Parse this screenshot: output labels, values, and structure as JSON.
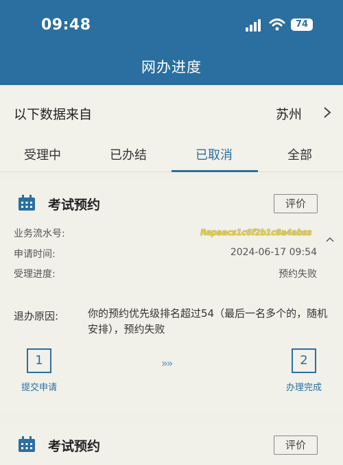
{
  "status": {
    "time": "09:48",
    "battery": "74"
  },
  "nav": {
    "title": "网办进度"
  },
  "source": {
    "label": "以下数据来自",
    "city": "苏州"
  },
  "tabs": [
    {
      "label": "受理中"
    },
    {
      "label": "已办结"
    },
    {
      "label": "已取消"
    },
    {
      "label": "全部"
    }
  ],
  "cards": [
    {
      "title": "考试预约",
      "rate_label": "评价",
      "serial_label": "业务流水号:",
      "serial_value": "Repaacs1c6f2b1c8a4abss",
      "apply_time_label": "申请时间:",
      "apply_time_value": "2024-06-17 09:54",
      "progress_label": "受理进度:",
      "progress_value": "预约失败",
      "reason_label": "退办原因:",
      "reason_text": "你的预约优先级排名超过54（最后一名多个的，随机安排），预约失败",
      "step1_number": "1",
      "step1_label": "提交申请",
      "step2_number": "2",
      "step2_label": "办理完成"
    },
    {
      "title": "考试预约",
      "rate_label": "评价"
    }
  ],
  "colors": {
    "primary": "#2a6fa0",
    "background": "#f0efe8"
  }
}
